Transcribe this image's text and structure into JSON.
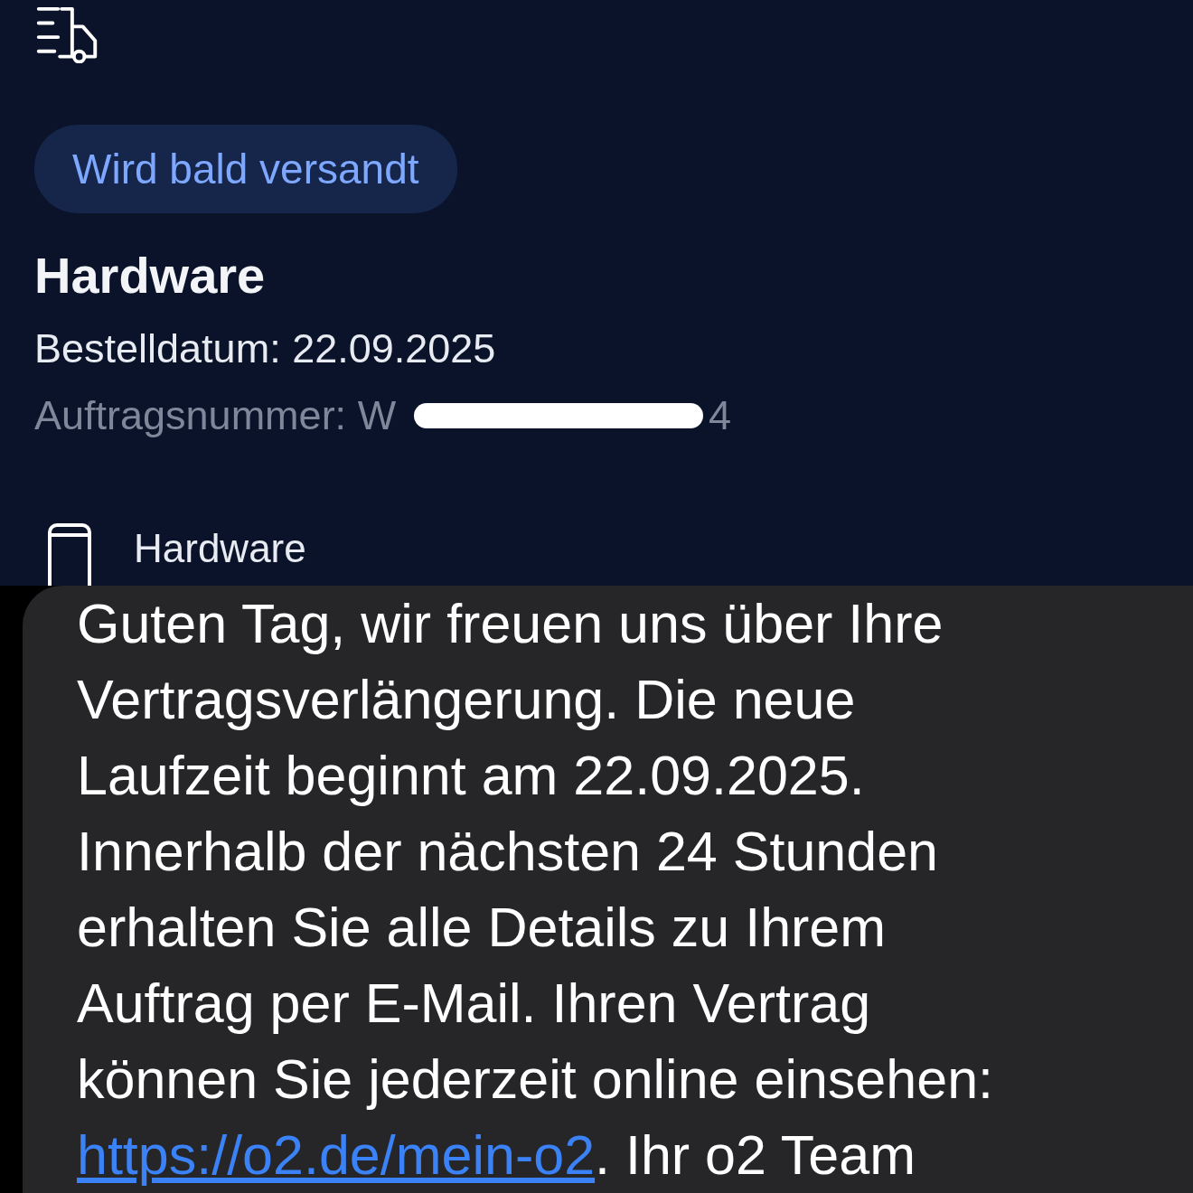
{
  "order": {
    "status_badge": "Wird bald versandt",
    "title": "Hardware",
    "order_date": "Bestelldatum: 22.09.2025",
    "order_number_start": "Auftragsnummer: W",
    "order_number_end": "4",
    "item": {
      "label": "Hardware"
    }
  },
  "message": {
    "text": "Guten Tag, wir freuen uns über Ihre\nVertragsverlängerung. Die neue\nLaufzeit beginnt am 22.09.2025.\nInnerhalb der nächsten 24 Stunden\nerhalten Sie alle Details zu Ihrem\nAuftrag per E-Mail. Ihren Vertrag\nkönnen Sie jederzeit online einsehen:\n",
    "link": "https://o2.de/mein-o2",
    "after_link": ". Ihr o2 Team"
  }
}
